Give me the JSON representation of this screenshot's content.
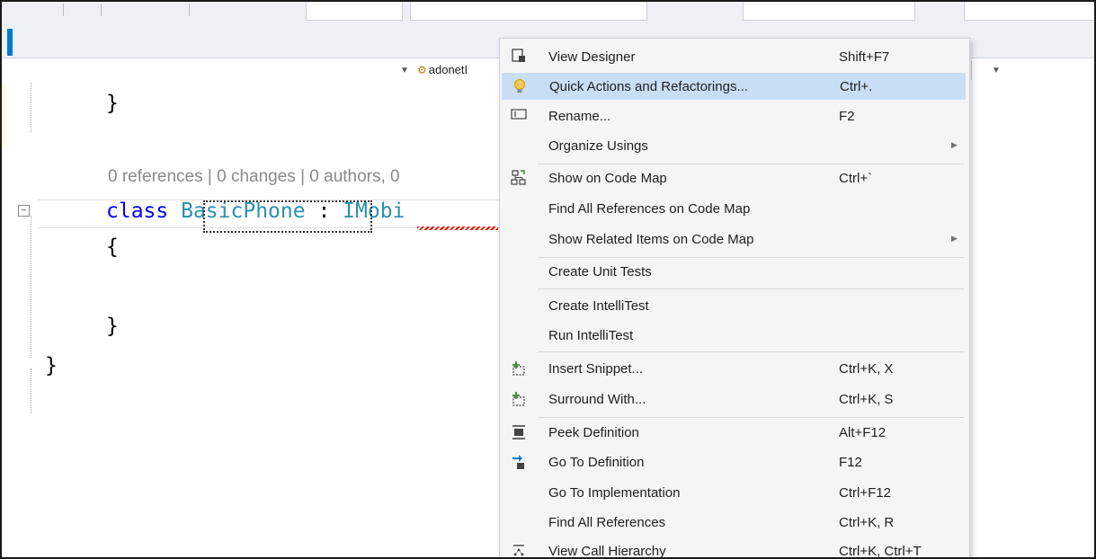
{
  "navbar": {
    "member_label": "adonetI"
  },
  "editor": {
    "line1": "}",
    "codelens": "0 references | 0 changes | 0 authors, 0",
    "class_keyword": "class",
    "class_name": "BasicPhone",
    "colon": ":",
    "interface_name": "IMobi",
    "open_brace": "{",
    "close_brace": "}",
    "ns_close_brace": "}"
  },
  "context_menu": {
    "items": [
      {
        "icon": "view-designer-icon",
        "label": "View Designer",
        "shortcut": "Shift+F7",
        "submenu": false,
        "highlighted": false
      },
      {
        "icon": "lightbulb-icon",
        "label": "Quick Actions and Refactorings...",
        "shortcut": "Ctrl+.",
        "submenu": false,
        "highlighted": true
      },
      {
        "icon": "rename-icon",
        "label": "Rename...",
        "shortcut": "F2",
        "submenu": false,
        "highlighted": false
      },
      {
        "icon": "",
        "label": "Organize Usings",
        "shortcut": "",
        "submenu": true,
        "highlighted": false
      },
      {
        "icon": "code-map-icon",
        "label": "Show on Code Map",
        "shortcut": "Ctrl+`",
        "submenu": false,
        "highlighted": false
      },
      {
        "icon": "",
        "label": "Find All References on Code Map",
        "shortcut": "",
        "submenu": false,
        "highlighted": false
      },
      {
        "icon": "",
        "label": "Show Related Items on Code Map",
        "shortcut": "",
        "submenu": true,
        "highlighted": false
      },
      {
        "icon": "",
        "label": "Create Unit Tests",
        "shortcut": "",
        "submenu": false,
        "highlighted": false
      },
      {
        "icon": "",
        "label": "Create IntelliTest",
        "shortcut": "",
        "submenu": false,
        "highlighted": false
      },
      {
        "icon": "",
        "label": "Run IntelliTest",
        "shortcut": "",
        "submenu": false,
        "highlighted": false
      },
      {
        "icon": "insert-snippet-icon",
        "label": "Insert Snippet...",
        "shortcut": "Ctrl+K, X",
        "submenu": false,
        "highlighted": false
      },
      {
        "icon": "surround-with-icon",
        "label": "Surround With...",
        "shortcut": "Ctrl+K, S",
        "submenu": false,
        "highlighted": false
      },
      {
        "icon": "peek-definition-icon",
        "label": "Peek Definition",
        "shortcut": "Alt+F12",
        "submenu": false,
        "highlighted": false
      },
      {
        "icon": "go-to-definition-icon",
        "label": "Go To Definition",
        "shortcut": "F12",
        "submenu": false,
        "highlighted": false
      },
      {
        "icon": "",
        "label": "Go To Implementation",
        "shortcut": "Ctrl+F12",
        "submenu": false,
        "highlighted": false
      },
      {
        "icon": "",
        "label": "Find All References",
        "shortcut": "Ctrl+K, R",
        "submenu": false,
        "highlighted": false
      },
      {
        "icon": "call-hierarchy-icon",
        "label": "View Call Hierarchy",
        "shortcut": "Ctrl+K, Ctrl+T",
        "submenu": false,
        "highlighted": false
      }
    ]
  },
  "colors": {
    "keyword": "#0000ff",
    "type": "#2b91af",
    "menu_highlight": "#c9def5",
    "accent": "#007acc",
    "lightbulb": "#f2c94c",
    "error_squiggle": "#e51400"
  }
}
